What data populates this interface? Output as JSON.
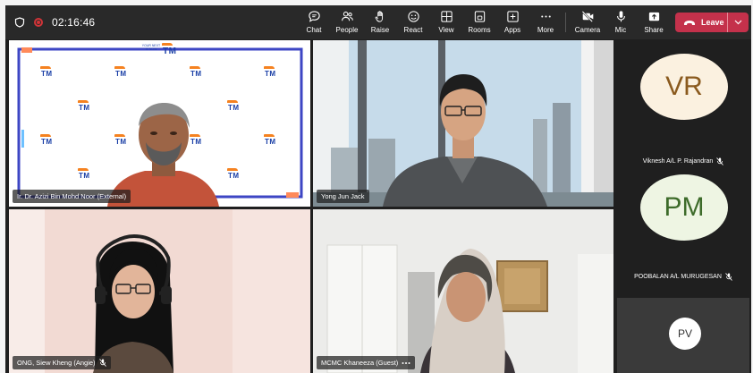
{
  "toolbar": {
    "timer": "02:16:46",
    "buttons": [
      {
        "label": "Chat",
        "icon": "chat-icon"
      },
      {
        "label": "People",
        "icon": "people-icon"
      },
      {
        "label": "Raise",
        "icon": "raise-hand-icon"
      },
      {
        "label": "React",
        "icon": "react-icon"
      },
      {
        "label": "View",
        "icon": "view-icon"
      },
      {
        "label": "Rooms",
        "icon": "rooms-icon"
      },
      {
        "label": "Apps",
        "icon": "apps-icon"
      },
      {
        "label": "More",
        "icon": "more-icon"
      },
      {
        "label": "Camera",
        "icon": "camera-off-icon"
      },
      {
        "label": "Mic",
        "icon": "mic-icon"
      },
      {
        "label": "Share",
        "icon": "share-icon"
      }
    ],
    "leave_label": "Leave",
    "leave_color": "#c4314b"
  },
  "participants": {
    "tile1": {
      "name": "Ir. Dr. Azizi Bin Mohd Noor (External)"
    },
    "tile2": {
      "name": "Yong Jun Jack"
    },
    "tile3": {
      "name": "ONG, Siew Kheng (Angie)"
    },
    "tile4": {
      "name": "MCMC Khaneeza (Guest)"
    },
    "side": [
      {
        "initials": "VR",
        "name": "Viknesh A/L P. Rajandran",
        "bg": "#fbf1e0",
        "fg": "#8a5a1e"
      },
      {
        "initials": "PM",
        "name": "POOBALAN A/L MURUGESAN",
        "bg": "#eef5e3",
        "fg": "#3d6b2a"
      },
      {
        "initials": "PV"
      }
    ]
  },
  "backdrop": {
    "logo_text": "TM",
    "slogan": "YOUR NEXT IS NOW"
  }
}
